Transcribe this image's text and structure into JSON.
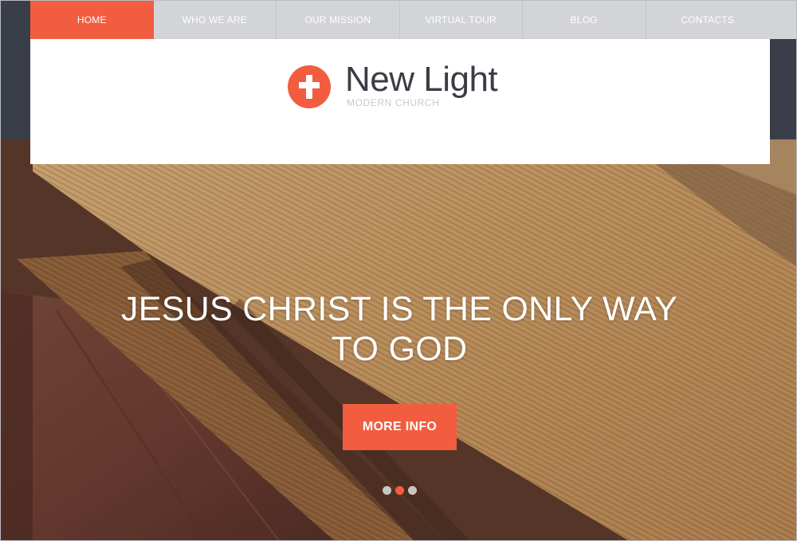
{
  "nav": {
    "items": [
      {
        "label": "HOME",
        "active": true
      },
      {
        "label": "WHO WE ARE",
        "active": false
      },
      {
        "label": "OUR MISSION",
        "active": false
      },
      {
        "label": "VIRTUAL TOUR",
        "active": false
      },
      {
        "label": "BLOG",
        "active": false
      },
      {
        "label": "CONTACTS",
        "active": false
      }
    ]
  },
  "brand": {
    "name": "New Light",
    "tagline": "MODERN CHURCH",
    "icon": "cross-icon"
  },
  "hero": {
    "headline_line1": "JESUS CHRIST IS THE ONLY WAY",
    "headline_line2": "TO GOD",
    "cta_label": "MORE INFO",
    "slides_total": 3,
    "active_slide": 2
  },
  "colors": {
    "accent": "#f25d3f",
    "nav_bg": "#d3d4d7",
    "top_band": "#3a3e48",
    "text_dark": "#3b3d45"
  }
}
